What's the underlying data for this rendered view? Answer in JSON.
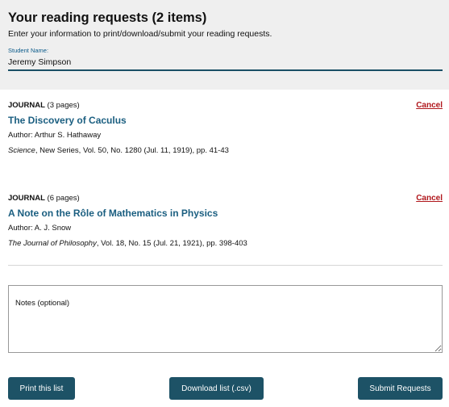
{
  "header": {
    "title": "Your reading requests (2 items)",
    "subtitle": "Enter your information to print/download/submit your reading requests.",
    "student_label": "Student Name:",
    "student_value": "Jeremy Simpson"
  },
  "items": [
    {
      "kind": "JOURNAL",
      "pages": " (3 pages)",
      "cancel": "Cancel",
      "title": "The Discovery of Caculus",
      "author": "Author: Arthur S. Hathaway",
      "journal": "Science",
      "citation_rest": ", New Series, Vol. 50, No. 1280 (Jul. 11, 1919), pp. 41-43"
    },
    {
      "kind": "JOURNAL",
      "pages": " (6 pages)",
      "cancel": "Cancel",
      "title": "A Note on the Rôle of Mathematics in Physics",
      "author": "Author: A. J. Snow",
      "journal": "The Journal of Philosophy",
      "citation_rest": ", Vol. 18, No. 15 (Jul. 21, 1921), pp. 398-403"
    }
  ],
  "notes": {
    "placeholder": "Notes (optional)"
  },
  "buttons": {
    "print": "Print this list",
    "download": "Download list (.csv)",
    "submit": "Submit Requests"
  },
  "colors": {
    "link": "#1a5e80",
    "cancel": "#b0161b",
    "button": "#1d5266"
  }
}
